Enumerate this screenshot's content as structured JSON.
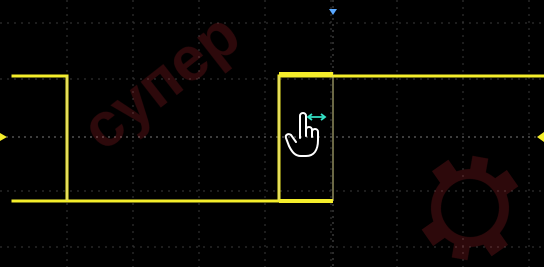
{
  "watermark": {
    "text": "супер",
    "color": "#cc2a33"
  },
  "scope": {
    "background": "#000000",
    "grid_color": "#3a3a3a",
    "center_line_color": "#7a7a7a",
    "trace_color": "#f5ee2b",
    "marker_color": "#f5ee2b",
    "top_marker_color": "#5aa8ff",
    "gesture_color": "#ffffff",
    "gesture_arrow_color": "#34e1c5",
    "gesture_icon": "hand-drag-horizontal-icon"
  }
}
